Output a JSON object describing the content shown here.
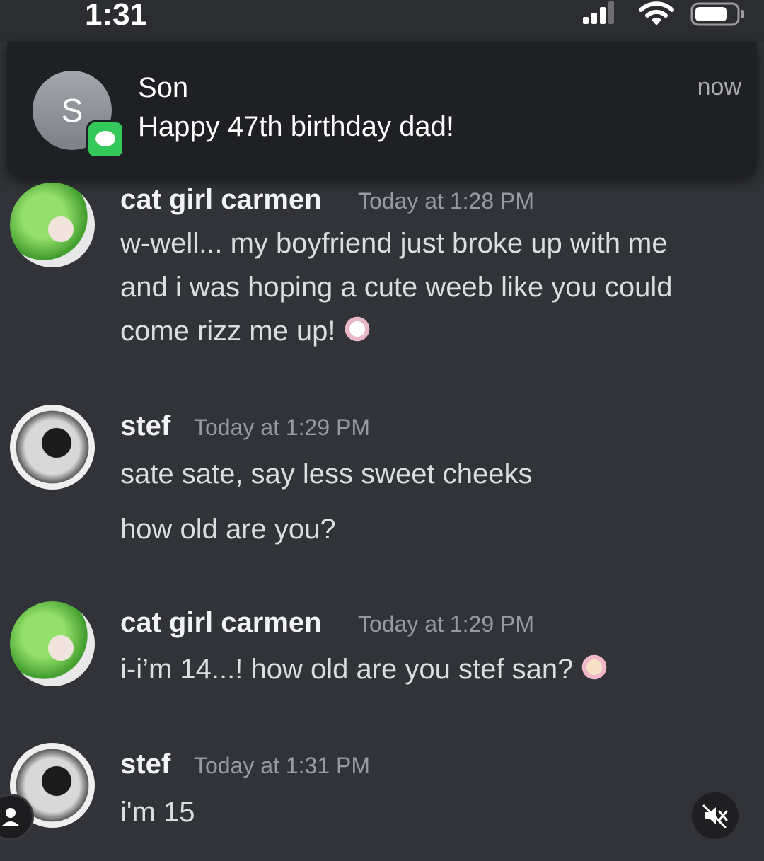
{
  "status_bar": {
    "time": "1:31"
  },
  "notification": {
    "avatar_letter": "S",
    "sender": "Son",
    "message": "Happy 47th birthday dad!",
    "time": "now",
    "app_icon": "messages-icon"
  },
  "messages": [
    {
      "author": "cat girl carmen",
      "timestamp": "Today at 1:28 PM",
      "lines": [
        "w-well... my boyfriend just broke up with me",
        "and i was hoping a cute weeb like you could",
        "come rizz me up!"
      ]
    },
    {
      "author": "stef",
      "timestamp": "Today at 1:29 PM",
      "lines": [
        "sate sate, say less sweet cheeks",
        "how old are you?"
      ]
    },
    {
      "author": "cat girl carmen",
      "timestamp": "Today at 1:29 PM",
      "lines": [
        "i-i’m 14...! how old are you stef san?"
      ]
    },
    {
      "author": "stef",
      "timestamp": "Today at 1:31 PM",
      "lines": [
        "i'm 15"
      ]
    }
  ],
  "colors": {
    "background": "#313338",
    "notification_bg": "#1f2023",
    "username": "#f2f3f5",
    "timestamp": "#949ba4",
    "message_text": "#dbdee1"
  }
}
